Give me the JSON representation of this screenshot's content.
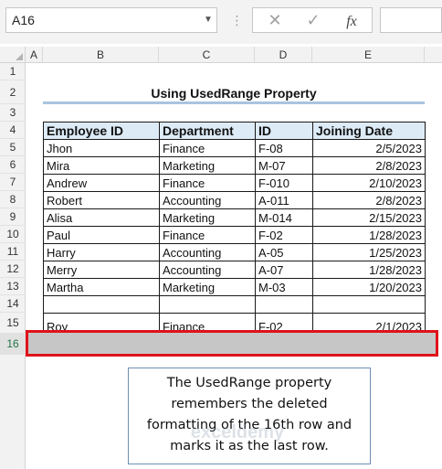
{
  "formula_bar": {
    "name_box": "A16",
    "cancel_icon": "✕",
    "confirm_icon": "✓",
    "function_icon": "fx",
    "formula": ""
  },
  "columns": [
    "A",
    "B",
    "C",
    "D",
    "E"
  ],
  "rows": [
    "1",
    "2",
    "3",
    "4",
    "5",
    "6",
    "7",
    "8",
    "9",
    "10",
    "11",
    "12",
    "13",
    "14",
    "15",
    "16"
  ],
  "sheet": {
    "title": "Using UsedRange Property",
    "table": {
      "headers": [
        "Employee ID",
        "Department",
        "ID",
        "Joining Date"
      ],
      "rows": [
        [
          "Jhon",
          "Finance",
          "F-08",
          "2/5/2023"
        ],
        [
          "Mira",
          "Marketing",
          "M-07",
          "2/8/2023"
        ],
        [
          "Andrew",
          "Finance",
          "F-010",
          "2/10/2023"
        ],
        [
          "Robert",
          "Accounting",
          "A-011",
          "2/8/2023"
        ],
        [
          "Alisa",
          "Marketing",
          "M-014",
          "2/15/2023"
        ],
        [
          "Paul",
          "Finance",
          "F-02",
          "1/28/2023"
        ],
        [
          "Harry",
          "Accounting",
          "A-05",
          "1/25/2023"
        ],
        [
          "Merry",
          "Accounting",
          "A-07",
          "1/28/2023"
        ],
        [
          "Martha",
          "Marketing",
          "M-03",
          "1/20/2023"
        ],
        [
          "",
          "",
          "",
          ""
        ],
        [
          "Roy",
          "Finance",
          "F-02",
          "2/1/2023"
        ]
      ]
    },
    "note_lines": [
      "The UsedRange property",
      "remembers the deleted",
      "formatting of the 16th row and",
      "marks it as the last row."
    ],
    "watermark": "exceldemy"
  },
  "colors": {
    "header_fill": "#ddebf7",
    "selection_outline": "#e0121a",
    "title_underline": "#a9c4df"
  }
}
